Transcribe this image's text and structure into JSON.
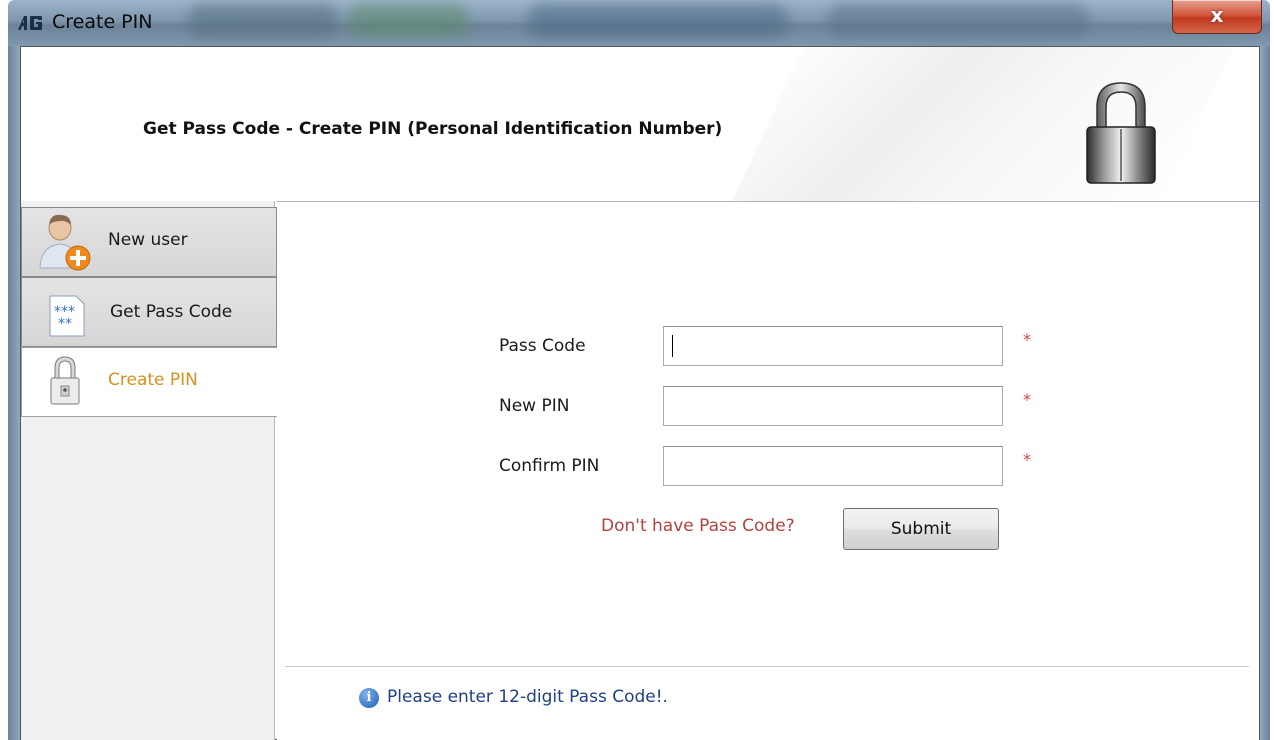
{
  "window": {
    "title": "Create PIN",
    "close_label": "x"
  },
  "header": {
    "title": "Get Pass Code - Create PIN (Personal Identification Number)"
  },
  "sidebar": {
    "items": [
      {
        "label": "New user",
        "icon": "user-add-icon",
        "active": false
      },
      {
        "label": "Get Pass Code",
        "icon": "passcode-icon",
        "active": false
      },
      {
        "label": "Create PIN",
        "icon": "lock-icon",
        "active": true
      }
    ]
  },
  "form": {
    "pass_code": {
      "label": "Pass Code",
      "value": "",
      "required_mark": "*"
    },
    "new_pin": {
      "label": "New PIN",
      "value": "",
      "required_mark": "*"
    },
    "confirm_pin": {
      "label": "Confirm PIN",
      "value": "",
      "required_mark": "*"
    },
    "no_pass_code_link": "Don't have Pass Code?",
    "submit_label": "Submit"
  },
  "status": {
    "message": "Please enter 12-digit Pass Code!.",
    "icon": "info-icon"
  },
  "colors": {
    "active_nav_text": "#d4911f",
    "link_text": "#b3423e",
    "status_text": "#1f3f86",
    "required_mark": "#d8403a"
  }
}
